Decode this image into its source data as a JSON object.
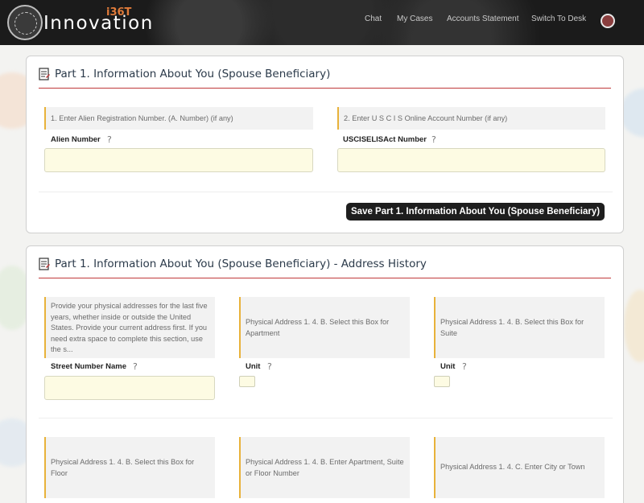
{
  "header": {
    "logo_text": "Innovation",
    "logo_superscript": "i36T",
    "nav": [
      "Chat",
      "My Cases",
      "Accounts Statement",
      "Switch To Desk"
    ]
  },
  "section1": {
    "title": "Part 1. Information About You (Spouse Beneficiary)",
    "field1_hint": "1. Enter Alien Registration Number. (A. Number) (if any)",
    "field1_label": "Alien Number",
    "field1_value": "",
    "field2_hint": "2. Enter U S C I S Online Account Number (if any)",
    "field2_label": "USCISELISAct Number",
    "field2_value": "",
    "save_label": "Save Part 1. Information About You (Spouse Beneficiary)"
  },
  "section2": {
    "title": "Part 1. Information About You (Spouse Beneficiary) - Address History",
    "street_hint": "Provide your physical addresses for the last five years, whether inside or outside the United States. Provide your current address first. If you need extra space to complete this section, use the s...",
    "street_label": "Street Number Name",
    "apt_hint": "Physical Address 1. 4. B. Select this Box for Apartment",
    "apt_label": "Unit",
    "suite_hint": "Physical Address 1. 4. B. Select this Box for Suite",
    "suite_label": "Unit",
    "floor_hint": "Physical Address 1. 4. B. Select this Box for Floor",
    "number_hint": "Physical Address 1. 4. B. Enter Apartment, Suite or Floor Number",
    "city_hint": "Physical Address 1. 4. C. Enter City or Town"
  },
  "colors": {
    "accent_red": "#c0393b",
    "hint_border": "#e8b23a",
    "input_bg": "#fdfbe3",
    "header_bg": "#1b1b1b"
  },
  "icons": [
    "document-icon",
    "help-question-icon",
    "seal-logo-icon",
    "user-avatar"
  ]
}
